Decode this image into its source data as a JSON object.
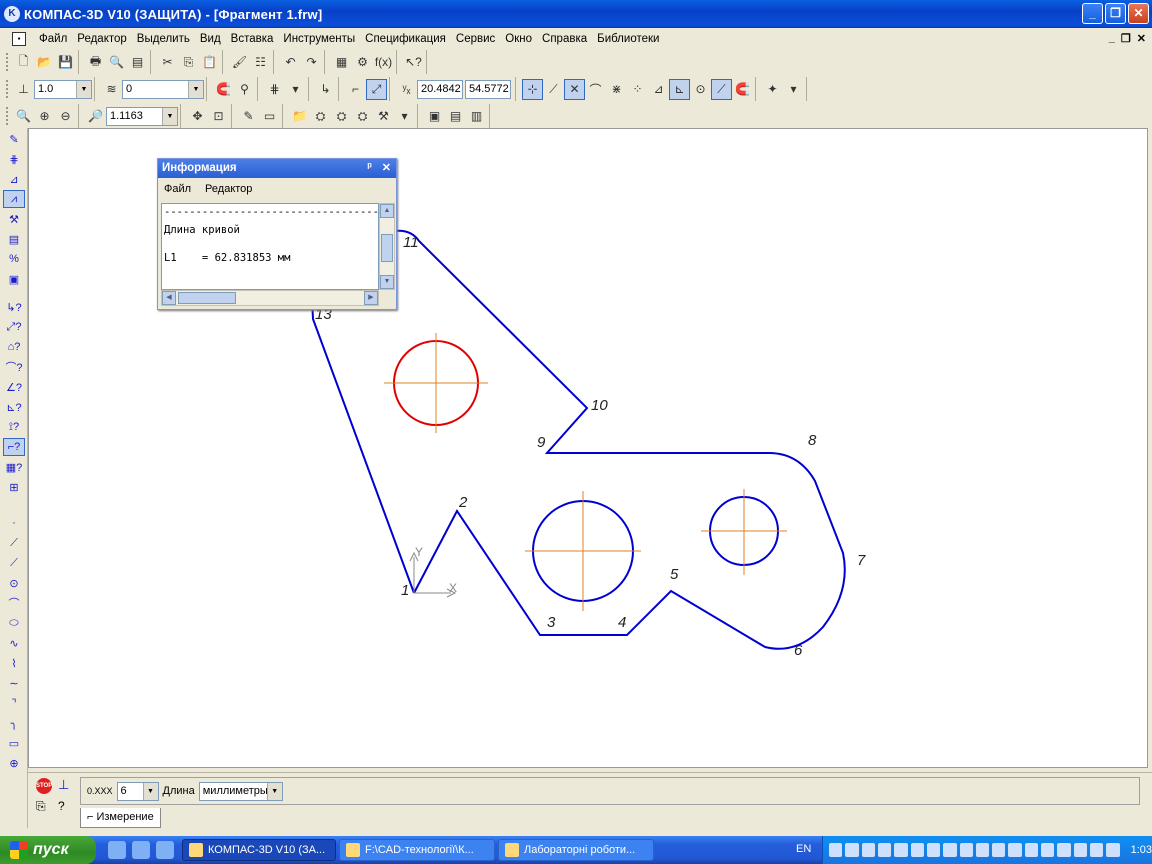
{
  "window": {
    "title": "КОМПАС-3D V10 (ЗАЩИТА) - [Фрагмент 1.frw]",
    "app_icon": "kompas-logo-icon",
    "minimize": "_",
    "restore": "❐",
    "close": "✕"
  },
  "menu": {
    "items": [
      "Файл",
      "Редактор",
      "Выделить",
      "Вид",
      "Вставка",
      "Инструменты",
      "Спецификация",
      "Сервис",
      "Окно",
      "Справка",
      "Библиотеки"
    ],
    "mdi_minimize": "_",
    "mdi_restore": "❐",
    "mdi_close": "✕"
  },
  "toolbar2": {
    "step_value": "1.0",
    "layer_value": "0",
    "coord_x": "20.4842",
    "coord_y": "54.5772"
  },
  "toolbar3": {
    "zoom_value": "1.1163"
  },
  "info_window": {
    "title": "Информация",
    "pin": "ᵖ",
    "close": "✕",
    "menu_file": "Файл",
    "menu_edit": "Редактор",
    "line1": "----------------------------------------",
    "line2": "Длина кривой",
    "line3": "",
    "line4": "L1    = 62.831853 мм"
  },
  "drawing": {
    "point_labels": [
      "1",
      "2",
      "3",
      "4",
      "5",
      "6",
      "7",
      "8",
      "9",
      "10",
      "11",
      "13"
    ],
    "axis_x": "X",
    "axis_y": "Y",
    "colors": {
      "contour": "#0000d0",
      "selected_circle": "#e00000",
      "axis": "#e08020"
    }
  },
  "property_bar": {
    "stop_label": "STOP",
    "precision_value": "6",
    "length_label": "Длина",
    "units_value": "миллиметры",
    "tab_label": "Измерение"
  },
  "taskbar": {
    "start_label": "пуск",
    "tasks": [
      "КОМПАС-3D V10 (ЗА...",
      "F:\\CAD-технології\\К...",
      "Лабораторні роботи..."
    ],
    "lang": "EN",
    "clock": "1:03"
  }
}
